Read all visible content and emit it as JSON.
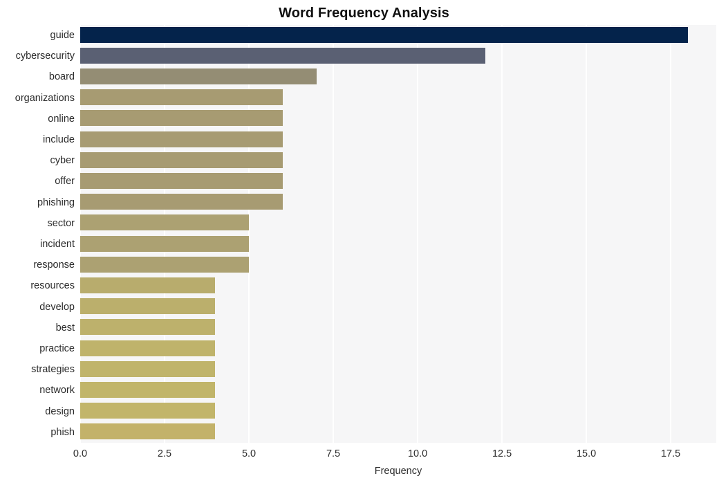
{
  "chart_data": {
    "type": "bar",
    "orientation": "horizontal",
    "title": "Word Frequency Analysis",
    "xlabel": "Frequency",
    "ylabel": "",
    "categories": [
      "guide",
      "cybersecurity",
      "board",
      "organizations",
      "online",
      "include",
      "cyber",
      "offer",
      "phishing",
      "sector",
      "incident",
      "response",
      "resources",
      "develop",
      "best",
      "practice",
      "strategies",
      "network",
      "design",
      "phish"
    ],
    "values": [
      18,
      12,
      7,
      6,
      6,
      6,
      6,
      6,
      6,
      5,
      5,
      5,
      4,
      4,
      4,
      4,
      4,
      4,
      4,
      4
    ],
    "bar_colors": [
      "#04234b",
      "#5a6073",
      "#948d74",
      "#a79b72",
      "#a79b72",
      "#a79b72",
      "#a79b72",
      "#a79b72",
      "#a79b72",
      "#aca172",
      "#aca172",
      "#aca172",
      "#b8ac6d",
      "#bbaf6c",
      "#bdb16c",
      "#bfb36b",
      "#c0b46b",
      "#c1b56a",
      "#c2b56a",
      "#c3b26a"
    ],
    "xlim": [
      0,
      18.85
    ],
    "xticks": [
      0.0,
      2.5,
      5.0,
      7.5,
      10.0,
      12.5,
      15.0,
      17.5
    ],
    "xtick_labels": [
      "0.0",
      "2.5",
      "5.0",
      "7.5",
      "10.0",
      "12.5",
      "15.0",
      "17.5"
    ],
    "grid": true,
    "grid_axis": "x",
    "grid_color": "#ffffff",
    "plot_background": "#f6f6f7",
    "figure_background": "#ffffff",
    "legend": null
  }
}
